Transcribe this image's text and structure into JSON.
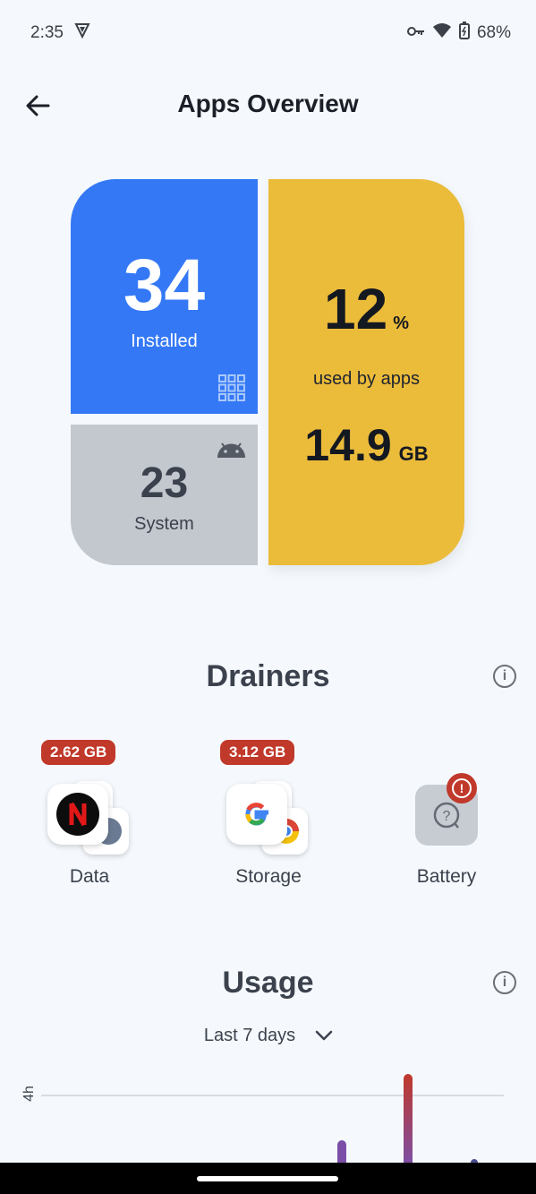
{
  "status": {
    "time": "2:35",
    "battery": "68%"
  },
  "header": {
    "title": "Apps Overview"
  },
  "overview": {
    "installed_count": "34",
    "installed_label": "Installed",
    "system_count": "23",
    "system_label": "System",
    "used_percent": "12",
    "used_percent_unit": "%",
    "used_label": "used by apps",
    "used_size": "14.9",
    "used_size_unit": "GB",
    "colors": {
      "installed": "#3478f6",
      "system": "#c3c7ce",
      "storage": "#ebbb3a"
    }
  },
  "drainers": {
    "title": "Drainers",
    "items": [
      {
        "label": "Data",
        "badge": "2.62 GB",
        "icon": "netflix-icon"
      },
      {
        "label": "Storage",
        "badge": "3.12 GB",
        "icon": "google-icon"
      },
      {
        "label": "Battery",
        "icon": "battery-question-icon",
        "alert": "!"
      }
    ]
  },
  "usage": {
    "title": "Usage",
    "period": "Last 7 days",
    "axis_label": "4h"
  }
}
